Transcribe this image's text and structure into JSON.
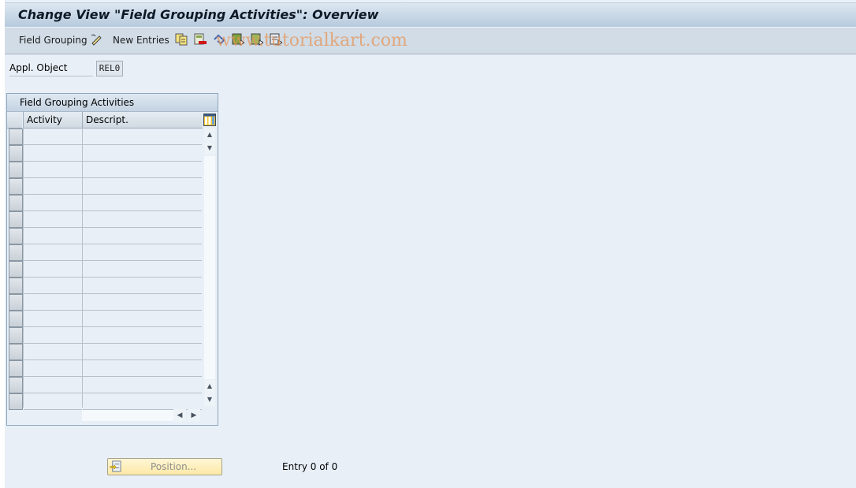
{
  "window": {
    "title": "Change View \"Field Grouping Activities\": Overview"
  },
  "toolbar": {
    "field_grouping_label": "Field Grouping",
    "new_entries_label": "New Entries",
    "icons": [
      "edit-display-icon",
      "copy-icon",
      "delete-icon",
      "undo-icon",
      "select-all-icon",
      "select-block-icon",
      "deselect-all-icon"
    ],
    "watermark": "www.tutorialkart.com"
  },
  "header_fields": {
    "appl_object_label": "Appl. Object",
    "appl_object_value": "REL0"
  },
  "table": {
    "title": "Field Grouping Activities",
    "columns": [
      "Activity",
      "Descript."
    ],
    "row_count_visible": 17,
    "rows": []
  },
  "footer": {
    "position_button_label": "Position...",
    "entry_status": "Entry 0 of 0"
  }
}
